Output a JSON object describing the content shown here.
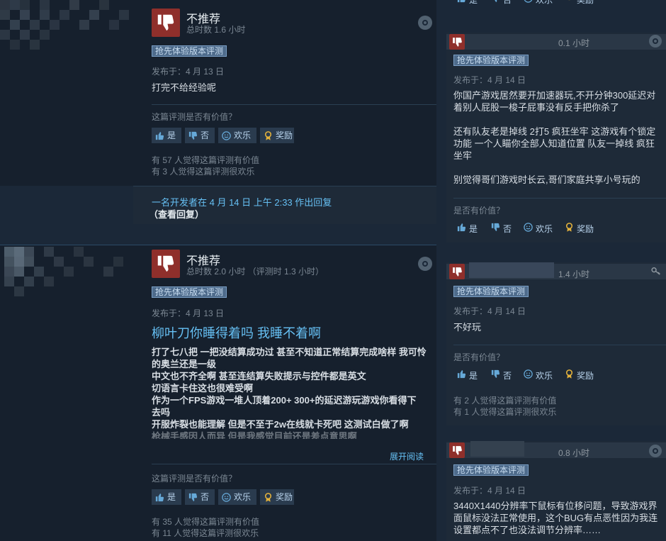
{
  "colors": {
    "bg": "#1b2838",
    "accent": "#66c0f4",
    "thumbs_down": "#8f2f2b"
  },
  "reviews": [
    {
      "verdict": "不推荐",
      "hours": "总时数 1.6 小时",
      "badge": "抢先体验版本评测",
      "posted": "发布于：4 月 13 日",
      "text": "打完不给经验呢",
      "helpful_q": "这篇评测是否有价值？",
      "buttons": {
        "yes": "是",
        "no": "否",
        "funny": "欢乐",
        "award": "奖励"
      },
      "stat1": "有 57 人觉得这篇评测有价值",
      "stat2": "有 3 人觉得这篇评测很欢乐",
      "dev_reply": "一名开发者在 4 月 14 日 上午 2:33 作出回复",
      "dev_link": "（查看回复）"
    },
    {
      "verdict": "不推荐",
      "hours": "总时数 2.0 小时 （评测时 1.3 小时）",
      "badge": "抢先体验版本评测",
      "posted": "发布于：4 月 13 日",
      "headline": "柳叶刀你睡得着吗 我睡不着啊",
      "lines": [
        "打了七八把 一把没结算成功过 甚至不知道正常结算完成啥样 我可怜",
        "的奥兰还是一级",
        "中文也不齐全啊 甚至连结算失败提示与控件都是英文",
        "切语言卡住这也很难受啊",
        "作为一个FPS游戏一堆人顶着200+ 300+的延迟游玩游戏你看得下",
        "去吗",
        "开服炸裂也能理解 但是不至于2w在线就卡死吧 这测试白做了啊",
        "枪械手感因人而异 但是我感觉目前还是差点意思啊"
      ],
      "read_more": "展开阅读",
      "helpful_q": "这篇评测是否有价值？",
      "buttons": {
        "yes": "是",
        "no": "否",
        "funny": "欢乐",
        "award": "奖励"
      },
      "stat1": "有 35 人觉得这篇评测有价值",
      "stat2": "有 11 人觉得这篇评测很欢乐"
    }
  ],
  "side": {
    "top_buttons": {
      "yes": "是",
      "no": "否",
      "funny": "欢乐",
      "award": "奖励"
    },
    "cards": [
      {
        "hours": "0.1 小时",
        "badge": "抢先体验版本评测",
        "posted": "发布于：4 月 14 日",
        "text": "你国产游戏居然要开加速器玩,不开分钟300延迟对着别人屁股一梭子屁事没有反手把你杀了\n\n还有队友老是掉线 2打5 疯狂坐牢 这游戏有个锁定功能 一个人瞄你全部人知道位置 队友一掉线 疯狂坐牢\n\n别觉得哥们游戏时长云,哥们家庭共享小号玩的",
        "helpful_q": "是否有价值？",
        "buttons": {
          "yes": "是",
          "no": "否",
          "funny": "欢乐",
          "award": "奖励"
        }
      },
      {
        "hours": "1.4 小时",
        "badge": "抢先体验版本评测",
        "posted": "发布于：4 月 14 日",
        "text": "不好玩",
        "helpful_q": "是否有价值？",
        "buttons": {
          "yes": "是",
          "no": "否",
          "funny": "欢乐",
          "award": "奖励"
        },
        "stat1": "有 2 人觉得这篇评测有价值",
        "stat2": "有 1 人觉得这篇评测很欢乐"
      },
      {
        "hours": "0.8 小时",
        "badge": "抢先体验版本评测",
        "posted": "发布于：4 月 14 日",
        "text": "3440X1440分辨率下鼠标有位移问题，导致游戏界面鼠标没法正常使用，这个BUG有点恶性因为我连设置都点不了也没法调节分辨率……"
      }
    ]
  }
}
